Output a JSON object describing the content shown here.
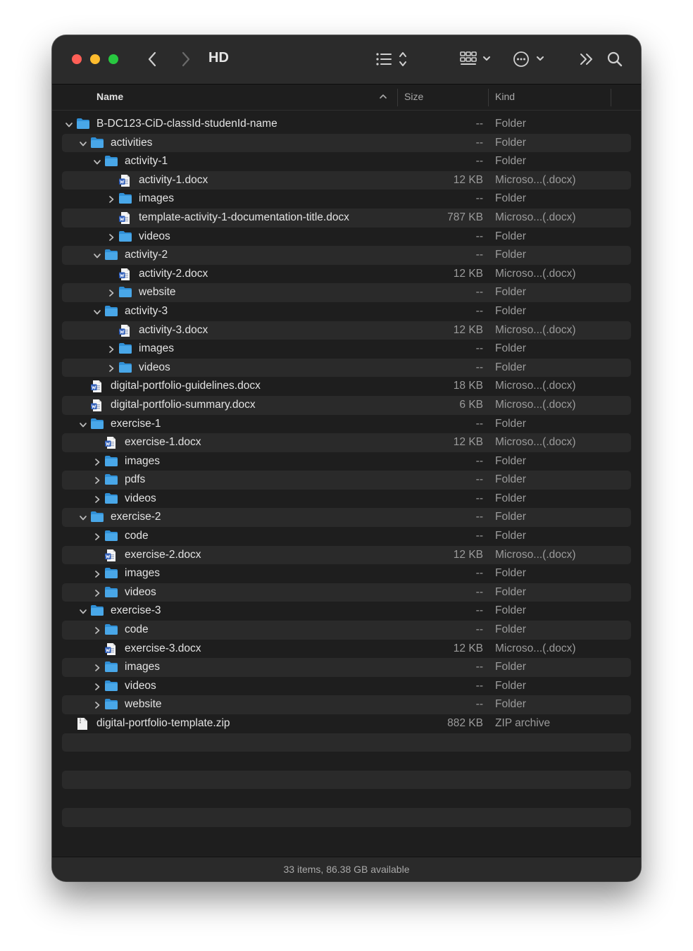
{
  "window": {
    "title": "HD"
  },
  "columns": {
    "name": "Name",
    "size": "Size",
    "kind": "Kind"
  },
  "rows": [
    {
      "name": "B-DC123-CiD-classId-studenId-name",
      "size": "--",
      "kind": "Folder",
      "depth": 0,
      "type": "folder",
      "disclosure": "open"
    },
    {
      "name": "activities",
      "size": "--",
      "kind": "Folder",
      "depth": 1,
      "type": "folder",
      "disclosure": "open"
    },
    {
      "name": "activity-1",
      "size": "--",
      "kind": "Folder",
      "depth": 2,
      "type": "folder",
      "disclosure": "open"
    },
    {
      "name": "activity-1.docx",
      "size": "12 KB",
      "kind": "Microso...(.docx)",
      "depth": 3,
      "type": "docx",
      "disclosure": "none"
    },
    {
      "name": "images",
      "size": "--",
      "kind": "Folder",
      "depth": 3,
      "type": "folder",
      "disclosure": "closed"
    },
    {
      "name": "template-activity-1-documentation-title.docx",
      "size": "787 KB",
      "kind": "Microso...(.docx)",
      "depth": 3,
      "type": "docx",
      "disclosure": "none"
    },
    {
      "name": "videos",
      "size": "--",
      "kind": "Folder",
      "depth": 3,
      "type": "folder",
      "disclosure": "closed"
    },
    {
      "name": "activity-2",
      "size": "--",
      "kind": "Folder",
      "depth": 2,
      "type": "folder",
      "disclosure": "open"
    },
    {
      "name": "activity-2.docx",
      "size": "12 KB",
      "kind": "Microso...(.docx)",
      "depth": 3,
      "type": "docx",
      "disclosure": "none"
    },
    {
      "name": "website",
      "size": "--",
      "kind": "Folder",
      "depth": 3,
      "type": "folder",
      "disclosure": "closed"
    },
    {
      "name": "activity-3",
      "size": "--",
      "kind": "Folder",
      "depth": 2,
      "type": "folder",
      "disclosure": "open"
    },
    {
      "name": "activity-3.docx",
      "size": "12 KB",
      "kind": "Microso...(.docx)",
      "depth": 3,
      "type": "docx",
      "disclosure": "none"
    },
    {
      "name": "images",
      "size": "--",
      "kind": "Folder",
      "depth": 3,
      "type": "folder",
      "disclosure": "closed"
    },
    {
      "name": "videos",
      "size": "--",
      "kind": "Folder",
      "depth": 3,
      "type": "folder",
      "disclosure": "closed"
    },
    {
      "name": "digital-portfolio-guidelines.docx",
      "size": "18 KB",
      "kind": "Microso...(.docx)",
      "depth": 1,
      "type": "docx",
      "disclosure": "none"
    },
    {
      "name": "digital-portfolio-summary.docx",
      "size": "6 KB",
      "kind": "Microso...(.docx)",
      "depth": 1,
      "type": "docx",
      "disclosure": "none"
    },
    {
      "name": "exercise-1",
      "size": "--",
      "kind": "Folder",
      "depth": 1,
      "type": "folder",
      "disclosure": "open"
    },
    {
      "name": "exercise-1.docx",
      "size": "12 KB",
      "kind": "Microso...(.docx)",
      "depth": 2,
      "type": "docx",
      "disclosure": "none"
    },
    {
      "name": "images",
      "size": "--",
      "kind": "Folder",
      "depth": 2,
      "type": "folder",
      "disclosure": "closed"
    },
    {
      "name": "pdfs",
      "size": "--",
      "kind": "Folder",
      "depth": 2,
      "type": "folder",
      "disclosure": "closed"
    },
    {
      "name": "videos",
      "size": "--",
      "kind": "Folder",
      "depth": 2,
      "type": "folder",
      "disclosure": "closed"
    },
    {
      "name": "exercise-2",
      "size": "--",
      "kind": "Folder",
      "depth": 1,
      "type": "folder",
      "disclosure": "open"
    },
    {
      "name": "code",
      "size": "--",
      "kind": "Folder",
      "depth": 2,
      "type": "folder",
      "disclosure": "closed"
    },
    {
      "name": "exercise-2.docx",
      "size": "12 KB",
      "kind": "Microso...(.docx)",
      "depth": 2,
      "type": "docx",
      "disclosure": "none"
    },
    {
      "name": "images",
      "size": "--",
      "kind": "Folder",
      "depth": 2,
      "type": "folder",
      "disclosure": "closed"
    },
    {
      "name": "videos",
      "size": "--",
      "kind": "Folder",
      "depth": 2,
      "type": "folder",
      "disclosure": "closed"
    },
    {
      "name": "exercise-3",
      "size": "--",
      "kind": "Folder",
      "depth": 1,
      "type": "folder",
      "disclosure": "open"
    },
    {
      "name": "code",
      "size": "--",
      "kind": "Folder",
      "depth": 2,
      "type": "folder",
      "disclosure": "closed"
    },
    {
      "name": "exercise-3.docx",
      "size": "12 KB",
      "kind": "Microso...(.docx)",
      "depth": 2,
      "type": "docx",
      "disclosure": "none"
    },
    {
      "name": "images",
      "size": "--",
      "kind": "Folder",
      "depth": 2,
      "type": "folder",
      "disclosure": "closed"
    },
    {
      "name": "videos",
      "size": "--",
      "kind": "Folder",
      "depth": 2,
      "type": "folder",
      "disclosure": "closed"
    },
    {
      "name": "website",
      "size": "--",
      "kind": "Folder",
      "depth": 2,
      "type": "folder",
      "disclosure": "closed"
    },
    {
      "name": "digital-portfolio-template.zip",
      "size": "882 KB",
      "kind": "ZIP archive",
      "depth": 0,
      "type": "zip",
      "disclosure": "none"
    }
  ],
  "status": "33 items, 86.38 GB available",
  "colors": {
    "folder": "#49a7e8",
    "folder_tab": "#2f8fd6",
    "docx_badge": "#2b5bb8",
    "background": "#1e1e1e",
    "stripe": "#2a2a2a"
  },
  "icons": {
    "back": "chevron-left-icon",
    "forward": "chevron-right-icon",
    "list_view": "list-view-icon",
    "group": "grid-group-icon",
    "more": "ellipsis-circle-icon",
    "overflow": "double-chevron-icon",
    "search": "search-icon"
  }
}
